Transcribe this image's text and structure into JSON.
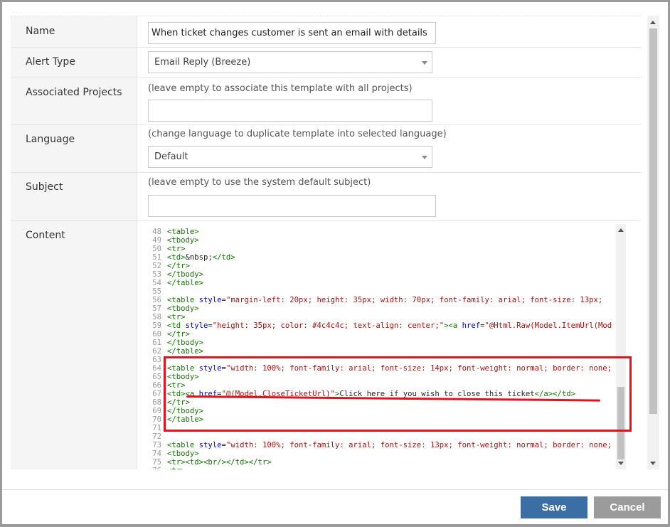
{
  "form": {
    "name": {
      "label": "Name",
      "value": "When ticket changes customer is sent an email with details"
    },
    "alert_type": {
      "label": "Alert Type",
      "value": "Email Reply (Breeze)"
    },
    "associated_projects": {
      "label": "Associated Projects",
      "hint": "(leave empty to associate this template with all projects)",
      "value": ""
    },
    "language": {
      "label": "Language",
      "hint": "(change language to duplicate template into selected language)",
      "value": "Default"
    },
    "subject": {
      "label": "Subject",
      "hint": "(leave empty to use the system default subject)",
      "value": ""
    },
    "content": {
      "label": "Content"
    }
  },
  "code_lines": [
    {
      "n": "48",
      "parts": [
        [
          "tag",
          "<table>"
        ]
      ]
    },
    {
      "n": "49",
      "parts": [
        [
          "tag",
          "<tbody>"
        ]
      ]
    },
    {
      "n": "50",
      "parts": [
        [
          "tag",
          "<tr>"
        ]
      ]
    },
    {
      "n": "51",
      "parts": [
        [
          "tag",
          "<td>"
        ],
        [
          "txt",
          "&nbsp;"
        ],
        [
          "tag",
          "</td>"
        ]
      ]
    },
    {
      "n": "52",
      "parts": [
        [
          "tag",
          "</tr>"
        ]
      ]
    },
    {
      "n": "53",
      "parts": [
        [
          "tag",
          "</tbody>"
        ]
      ]
    },
    {
      "n": "54",
      "parts": [
        [
          "tag",
          "</table>"
        ]
      ]
    },
    {
      "n": "55",
      "parts": []
    },
    {
      "n": "56",
      "parts": [
        [
          "tag",
          "<table "
        ],
        [
          "attr",
          "style"
        ],
        [
          "txt",
          "="
        ],
        [
          "str",
          "\"margin-left: 20px; height: 35px; width: 70px;  font-family: arial; font-size: 13px;"
        ]
      ]
    },
    {
      "n": "57",
      "parts": [
        [
          "tag",
          "<tbody>"
        ]
      ]
    },
    {
      "n": "58",
      "parts": [
        [
          "tag",
          "<tr>"
        ]
      ]
    },
    {
      "n": "59",
      "parts": [
        [
          "tag",
          "<td "
        ],
        [
          "attr",
          "style"
        ],
        [
          "txt",
          "="
        ],
        [
          "str",
          "\"height: 35px; color: #4c4c4c; text-align: center;\""
        ],
        [
          "tag",
          "><a "
        ],
        [
          "attr",
          "href"
        ],
        [
          "txt",
          "="
        ],
        [
          "str",
          "\"@Html.Raw(Model.ItemUrl(Mod"
        ]
      ]
    },
    {
      "n": "60",
      "parts": [
        [
          "tag",
          "</tr>"
        ]
      ]
    },
    {
      "n": "61",
      "parts": [
        [
          "tag",
          "</tbody>"
        ]
      ]
    },
    {
      "n": "62",
      "parts": [
        [
          "tag",
          "</table>"
        ]
      ]
    },
    {
      "n": "63",
      "parts": []
    },
    {
      "n": "64",
      "parts": [
        [
          "tag",
          "<table "
        ],
        [
          "attr",
          "style"
        ],
        [
          "txt",
          "="
        ],
        [
          "str",
          "\"width: 100%; font-family: arial; font-size: 14px; font-weight: normal; border: none;"
        ]
      ]
    },
    {
      "n": "65",
      "parts": [
        [
          "tag",
          "<tbody>"
        ]
      ]
    },
    {
      "n": "66",
      "parts": [
        [
          "tag",
          "<tr>"
        ]
      ]
    },
    {
      "n": "67",
      "parts": [
        [
          "tag",
          "<td><a "
        ],
        [
          "attr",
          "href"
        ],
        [
          "txt",
          "="
        ],
        [
          "str",
          "\"@(Model.CloseTicketUrl)\""
        ],
        [
          "tag",
          ">"
        ],
        [
          "txt",
          "Click here if you wish to close this ticket"
        ],
        [
          "tag",
          "</a></td>"
        ]
      ]
    },
    {
      "n": "68",
      "parts": [
        [
          "tag",
          "</tr>"
        ]
      ]
    },
    {
      "n": "69",
      "parts": [
        [
          "tag",
          "</tbody>"
        ]
      ]
    },
    {
      "n": "70",
      "parts": [
        [
          "tag",
          "</table>"
        ]
      ]
    },
    {
      "n": "71",
      "parts": []
    },
    {
      "n": "72",
      "parts": []
    },
    {
      "n": "73",
      "parts": [
        [
          "tag",
          "<table "
        ],
        [
          "attr",
          "style"
        ],
        [
          "txt",
          "="
        ],
        [
          "str",
          "\"width: 100%; font-family: arial; font-size: 13px; font-weight: normal; border: none;"
        ]
      ]
    },
    {
      "n": "74",
      "parts": [
        [
          "tag",
          "<tbody>"
        ]
      ]
    },
    {
      "n": "75",
      "parts": [
        [
          "tag",
          "<tr><td><br/></td></tr>"
        ]
      ]
    },
    {
      "n": "76",
      "parts": [
        [
          "tag",
          "<tr>"
        ]
      ]
    }
  ],
  "buttons": {
    "save": "Save",
    "cancel": "Cancel"
  },
  "colors": {
    "primary": "#3a6ea5",
    "cancel": "#9b9b9b",
    "annotation": "#e2131f"
  }
}
